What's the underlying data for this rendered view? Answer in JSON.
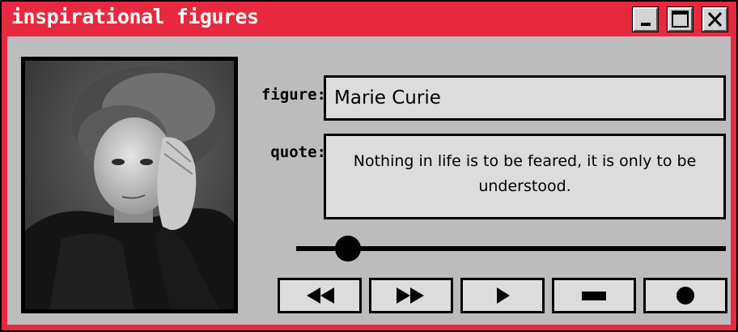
{
  "window": {
    "title": "inspirational figures",
    "controls": [
      "minimize-icon",
      "maximize-icon",
      "close-icon"
    ]
  },
  "photo": {
    "subject": "portrait-photo"
  },
  "fields": {
    "figure_label": "figure:",
    "figure_value": "Marie Curie",
    "quote_label": "quote:",
    "quote_value": "Nothing in life is to be feared, it is only to be understood."
  },
  "progress": {
    "value_fraction": 0.12
  },
  "controls": [
    {
      "name": "rewind-icon"
    },
    {
      "name": "fast-forward-icon"
    },
    {
      "name": "play-icon"
    },
    {
      "name": "stop-icon"
    },
    {
      "name": "record-icon"
    }
  ],
  "colors": {
    "frame": "#e8283f",
    "panel": "#bcbcbc",
    "field": "#dcdcdc",
    "ink": "#000000"
  }
}
